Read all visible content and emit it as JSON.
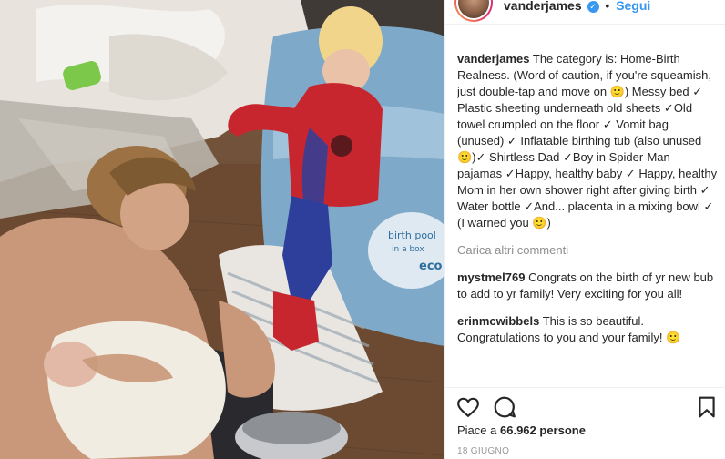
{
  "photo": {
    "tub_label": "birth pool\nin a box",
    "tub_brand": "eco"
  },
  "header": {
    "username": "vanderjames",
    "separator": "•",
    "follow_label": "Segui"
  },
  "caption": {
    "author": "vanderjames",
    "text": "The category is: Home-Birth Realness. (Word of caution, if you're squeamish, just double-tap and move on 🙂) Messy bed ✓ Plastic sheeting underneath old sheets ✓Old towel crumpled on the floor ✓ Vomit bag (unused) ✓ Inflatable birthing tub (also unused 🙂)✓ Shirtless Dad ✓Boy in Spider-Man pajamas ✓Happy, healthy baby ✓ Happy, healthy Mom in her own shower right after giving birth ✓ Water bottle ✓And... placenta in a mixing bowl ✓ (I warned you 🙂)"
  },
  "load_more": "Carica altri commenti",
  "comments": [
    {
      "author": "mystmel769",
      "text": "Congrats on the birth of yr new bub to add to yr family! Very exciting for you all!"
    },
    {
      "author": "erinmcwibbels",
      "text": "This is so beautiful. Congratulations to you and your family! 🙂"
    }
  ],
  "actions": {
    "icons": [
      "heart-icon",
      "comment-icon",
      "bookmark-icon"
    ]
  },
  "likes": {
    "prefix": "Piace a",
    "count": "66.962 persone"
  },
  "date": "18 GIUGNO"
}
